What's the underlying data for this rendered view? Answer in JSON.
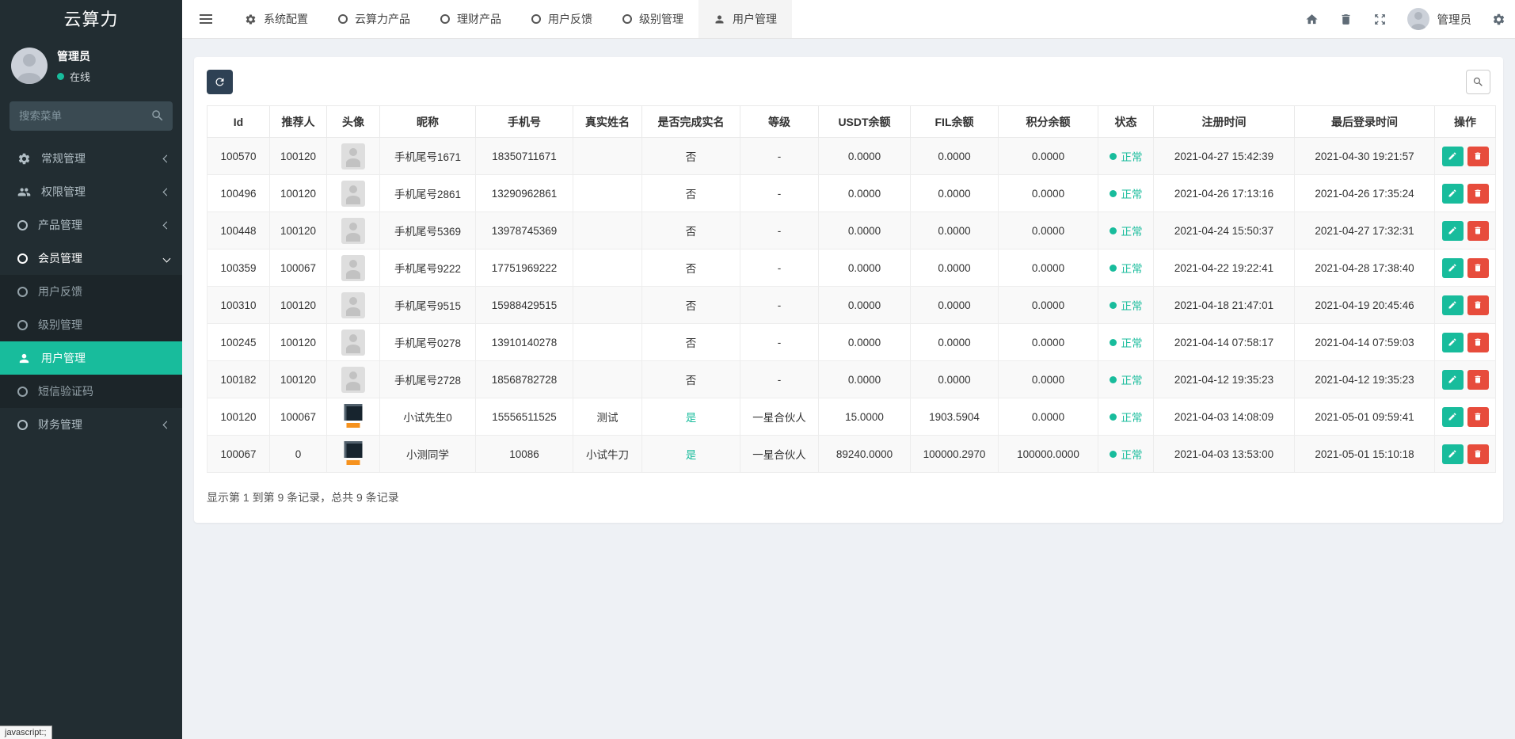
{
  "brand": {
    "title": "云算力"
  },
  "sidebar": {
    "user": {
      "name": "管理员",
      "status": "在线"
    },
    "search": {
      "placeholder": "搜索菜单"
    },
    "menu": [
      {
        "label": "常规管理",
        "icon": "gears-icon"
      },
      {
        "label": "权限管理",
        "icon": "users-icon"
      },
      {
        "label": "产品管理",
        "icon": "circle-icon"
      },
      {
        "label": "会员管理",
        "icon": "circle-icon",
        "open": true
      },
      {
        "label": "用户反馈",
        "icon": "circle-icon"
      },
      {
        "label": "级别管理",
        "icon": "circle-icon"
      },
      {
        "label": "用户管理",
        "icon": "person-icon",
        "active": true
      },
      {
        "label": "短信验证码",
        "icon": "circle-icon"
      },
      {
        "label": "财务管理",
        "icon": "circle-icon"
      }
    ]
  },
  "navbar": {
    "tabs": [
      {
        "label": "系统配置",
        "icon": "gear-icon"
      },
      {
        "label": "云算力产品",
        "icon": "circle-icon"
      },
      {
        "label": "理财产品",
        "icon": "circle-icon"
      },
      {
        "label": "用户反馈",
        "icon": "circle-icon"
      },
      {
        "label": "级别管理",
        "icon": "circle-icon"
      },
      {
        "label": "用户管理",
        "icon": "person-icon",
        "active": true
      }
    ],
    "user_name": "管理员"
  },
  "table": {
    "columns": [
      "Id",
      "推荐人",
      "头像",
      "昵称",
      "手机号",
      "真实姓名",
      "是否完成实名",
      "等级",
      "USDT余额",
      "FIL余额",
      "积分余额",
      "状态",
      "注册时间",
      "最后登录时间",
      "操作"
    ],
    "rows": [
      {
        "id": "100570",
        "ref": "100120",
        "avatar": "placeholder",
        "nickname": "手机尾号1671",
        "phone": "18350711671",
        "realname": "",
        "verified": "否",
        "level": "-",
        "usdt": "0.0000",
        "fil": "0.0000",
        "points": "0.0000",
        "status": "正常",
        "reg_time": "2021-04-27 15:42:39",
        "login_time": "2021-04-30 19:21:57"
      },
      {
        "id": "100496",
        "ref": "100120",
        "avatar": "placeholder",
        "nickname": "手机尾号2861",
        "phone": "13290962861",
        "realname": "",
        "verified": "否",
        "level": "-",
        "usdt": "0.0000",
        "fil": "0.0000",
        "points": "0.0000",
        "status": "正常",
        "reg_time": "2021-04-26 17:13:16",
        "login_time": "2021-04-26 17:35:24"
      },
      {
        "id": "100448",
        "ref": "100120",
        "avatar": "placeholder",
        "nickname": "手机尾号5369",
        "phone": "13978745369",
        "realname": "",
        "verified": "否",
        "level": "-",
        "usdt": "0.0000",
        "fil": "0.0000",
        "points": "0.0000",
        "status": "正常",
        "reg_time": "2021-04-24 15:50:37",
        "login_time": "2021-04-27 17:32:31"
      },
      {
        "id": "100359",
        "ref": "100067",
        "avatar": "placeholder",
        "nickname": "手机尾号9222",
        "phone": "17751969222",
        "realname": "",
        "verified": "否",
        "level": "-",
        "usdt": "0.0000",
        "fil": "0.0000",
        "points": "0.0000",
        "status": "正常",
        "reg_time": "2021-04-22 19:22:41",
        "login_time": "2021-04-28 17:38:40"
      },
      {
        "id": "100310",
        "ref": "100120",
        "avatar": "placeholder",
        "nickname": "手机尾号9515",
        "phone": "15988429515",
        "realname": "",
        "verified": "否",
        "level": "-",
        "usdt": "0.0000",
        "fil": "0.0000",
        "points": "0.0000",
        "status": "正常",
        "reg_time": "2021-04-18 21:47:01",
        "login_time": "2021-04-19 20:45:46"
      },
      {
        "id": "100245",
        "ref": "100120",
        "avatar": "placeholder",
        "nickname": "手机尾号0278",
        "phone": "13910140278",
        "realname": "",
        "verified": "否",
        "level": "-",
        "usdt": "0.0000",
        "fil": "0.0000",
        "points": "0.0000",
        "status": "正常",
        "reg_time": "2021-04-14 07:58:17",
        "login_time": "2021-04-14 07:59:03"
      },
      {
        "id": "100182",
        "ref": "100120",
        "avatar": "placeholder",
        "nickname": "手机尾号2728",
        "phone": "18568782728",
        "realname": "",
        "verified": "否",
        "level": "-",
        "usdt": "0.0000",
        "fil": "0.0000",
        "points": "0.0000",
        "status": "正常",
        "reg_time": "2021-04-12 19:35:23",
        "login_time": "2021-04-12 19:35:23"
      },
      {
        "id": "100120",
        "ref": "100067",
        "avatar": "logo",
        "nickname": "小试先生0",
        "phone": "15556511525",
        "realname": "测试",
        "verified": "是",
        "level": "一星合伙人",
        "usdt": "15.0000",
        "fil": "1903.5904",
        "points": "0.0000",
        "status": "正常",
        "reg_time": "2021-04-03 14:08:09",
        "login_time": "2021-05-01 09:59:41"
      },
      {
        "id": "100067",
        "ref": "0",
        "avatar": "logo",
        "nickname": "小测同学",
        "phone": "10086",
        "realname": "小试牛刀",
        "verified": "是",
        "level": "一星合伙人",
        "usdt": "89240.0000",
        "fil": "100000.2970",
        "points": "100000.0000",
        "status": "正常",
        "reg_time": "2021-04-03 13:53:00",
        "login_time": "2021-05-01 15:10:18"
      }
    ],
    "summary": "显示第 1 到第 9 条记录，总共 9 条记录"
  },
  "statusbar": {
    "text": "javascript:;"
  },
  "colors": {
    "accent": "#18bc9c",
    "danger": "#e74c3c",
    "sidebar": "#222d32",
    "toolbar_button": "#2e4154"
  }
}
